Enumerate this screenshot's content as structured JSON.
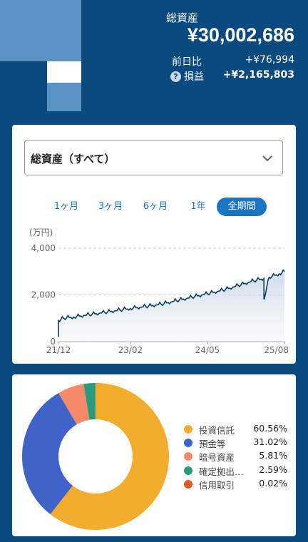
{
  "header": {
    "label": "総資産",
    "total": "¥30,002,686",
    "day_change_label": "前日比",
    "day_change_value": "+¥76,994",
    "help_icon": "?",
    "profit_label": "損益",
    "profit_value": "+¥2,165,803"
  },
  "colors": {
    "background": "#0b4a7f",
    "logo_light": "#5a93c3",
    "accent": "#1a76c0",
    "line": "#0b3c66"
  },
  "selector": {
    "value": "総資産（すべて）",
    "icon": "chevron-down-icon"
  },
  "periods": [
    {
      "label": "1ヶ月",
      "active": false
    },
    {
      "label": "3ヶ月",
      "active": false
    },
    {
      "label": "6ヶ月",
      "active": false
    },
    {
      "label": "1年",
      "active": false
    },
    {
      "label": "全期間",
      "active": true
    }
  ],
  "chart_data": [
    {
      "type": "area",
      "ylabel": "(万円)",
      "ylim": [
        0,
        4000
      ],
      "yticks": [
        "0",
        "2,000",
        "4,000"
      ],
      "xticks": [
        "21/12",
        "23/02",
        "24/05",
        "25/08"
      ],
      "grid": true,
      "series": [
        {
          "values": [
            {
              "x": "2021-12",
              "y": 200
            },
            {
              "x": "2021-12",
              "y": 900
            },
            {
              "x": "2022-01",
              "y": 1000
            },
            {
              "x": "2022-03",
              "y": 1050
            },
            {
              "x": "2022-06",
              "y": 1150
            },
            {
              "x": "2022-09",
              "y": 1250
            },
            {
              "x": "2022-12",
              "y": 1350
            },
            {
              "x": "2023-02",
              "y": 1420
            },
            {
              "x": "2023-05",
              "y": 1500
            },
            {
              "x": "2023-08",
              "y": 1600
            },
            {
              "x": "2023-11",
              "y": 1750
            },
            {
              "x": "2024-02",
              "y": 1900
            },
            {
              "x": "2024-05",
              "y": 2050
            },
            {
              "x": "2024-08",
              "y": 2200
            },
            {
              "x": "2024-11",
              "y": 2400
            },
            {
              "x": "2025-02",
              "y": 2600
            },
            {
              "x": "2025-04",
              "y": 2700
            },
            {
              "x": "2025-04",
              "y": 1800
            },
            {
              "x": "2025-05",
              "y": 2750
            },
            {
              "x": "2025-07",
              "y": 2900
            },
            {
              "x": "2025-08",
              "y": 3000
            }
          ]
        }
      ]
    },
    {
      "type": "pie",
      "series": [
        {
          "name": "投資信託",
          "value": 60.56,
          "label": "60.56%",
          "color": "#f2ac2e"
        },
        {
          "name": "預金等",
          "value": 31.02,
          "label": "31.02%",
          "color": "#3f63c9"
        },
        {
          "name": "暗号資産",
          "value": 5.81,
          "label": "5.81%",
          "color": "#f5896a"
        },
        {
          "name": "確定拠出…",
          "value": 2.59,
          "label": "2.59%",
          "color": "#2a9a7c"
        },
        {
          "name": "信用取引",
          "value": 0.02,
          "label": "0.02%",
          "color": "#e0581c"
        }
      ]
    }
  ]
}
